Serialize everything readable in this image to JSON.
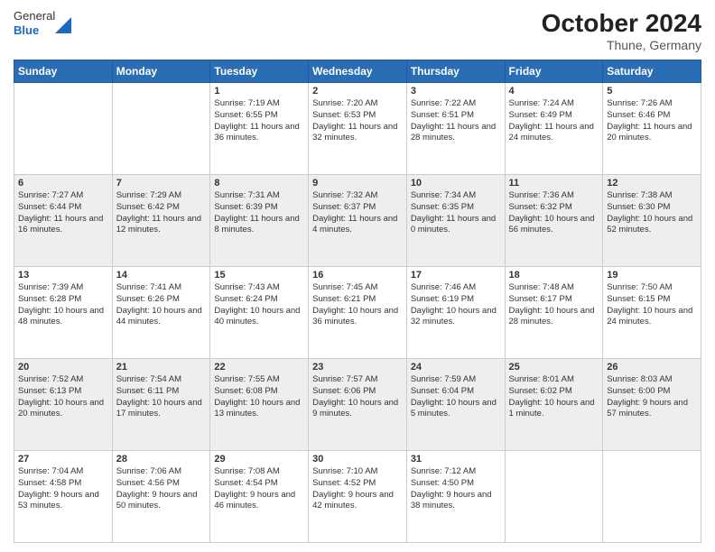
{
  "logo": {
    "line1": "General",
    "line2": "Blue"
  },
  "title": "October 2024",
  "subtitle": "Thune, Germany",
  "days": [
    "Sunday",
    "Monday",
    "Tuesday",
    "Wednesday",
    "Thursday",
    "Friday",
    "Saturday"
  ],
  "weeks": [
    [
      {
        "num": "",
        "content": ""
      },
      {
        "num": "",
        "content": ""
      },
      {
        "num": "1",
        "content": "Sunrise: 7:19 AM\nSunset: 6:55 PM\nDaylight: 11 hours and 36 minutes."
      },
      {
        "num": "2",
        "content": "Sunrise: 7:20 AM\nSunset: 6:53 PM\nDaylight: 11 hours and 32 minutes."
      },
      {
        "num": "3",
        "content": "Sunrise: 7:22 AM\nSunset: 6:51 PM\nDaylight: 11 hours and 28 minutes."
      },
      {
        "num": "4",
        "content": "Sunrise: 7:24 AM\nSunset: 6:49 PM\nDaylight: 11 hours and 24 minutes."
      },
      {
        "num": "5",
        "content": "Sunrise: 7:26 AM\nSunset: 6:46 PM\nDaylight: 11 hours and 20 minutes."
      }
    ],
    [
      {
        "num": "6",
        "content": "Sunrise: 7:27 AM\nSunset: 6:44 PM\nDaylight: 11 hours and 16 minutes."
      },
      {
        "num": "7",
        "content": "Sunrise: 7:29 AM\nSunset: 6:42 PM\nDaylight: 11 hours and 12 minutes."
      },
      {
        "num": "8",
        "content": "Sunrise: 7:31 AM\nSunset: 6:39 PM\nDaylight: 11 hours and 8 minutes."
      },
      {
        "num": "9",
        "content": "Sunrise: 7:32 AM\nSunset: 6:37 PM\nDaylight: 11 hours and 4 minutes."
      },
      {
        "num": "10",
        "content": "Sunrise: 7:34 AM\nSunset: 6:35 PM\nDaylight: 11 hours and 0 minutes."
      },
      {
        "num": "11",
        "content": "Sunrise: 7:36 AM\nSunset: 6:32 PM\nDaylight: 10 hours and 56 minutes."
      },
      {
        "num": "12",
        "content": "Sunrise: 7:38 AM\nSunset: 6:30 PM\nDaylight: 10 hours and 52 minutes."
      }
    ],
    [
      {
        "num": "13",
        "content": "Sunrise: 7:39 AM\nSunset: 6:28 PM\nDaylight: 10 hours and 48 minutes."
      },
      {
        "num": "14",
        "content": "Sunrise: 7:41 AM\nSunset: 6:26 PM\nDaylight: 10 hours and 44 minutes."
      },
      {
        "num": "15",
        "content": "Sunrise: 7:43 AM\nSunset: 6:24 PM\nDaylight: 10 hours and 40 minutes."
      },
      {
        "num": "16",
        "content": "Sunrise: 7:45 AM\nSunset: 6:21 PM\nDaylight: 10 hours and 36 minutes."
      },
      {
        "num": "17",
        "content": "Sunrise: 7:46 AM\nSunset: 6:19 PM\nDaylight: 10 hours and 32 minutes."
      },
      {
        "num": "18",
        "content": "Sunrise: 7:48 AM\nSunset: 6:17 PM\nDaylight: 10 hours and 28 minutes."
      },
      {
        "num": "19",
        "content": "Sunrise: 7:50 AM\nSunset: 6:15 PM\nDaylight: 10 hours and 24 minutes."
      }
    ],
    [
      {
        "num": "20",
        "content": "Sunrise: 7:52 AM\nSunset: 6:13 PM\nDaylight: 10 hours and 20 minutes."
      },
      {
        "num": "21",
        "content": "Sunrise: 7:54 AM\nSunset: 6:11 PM\nDaylight: 10 hours and 17 minutes."
      },
      {
        "num": "22",
        "content": "Sunrise: 7:55 AM\nSunset: 6:08 PM\nDaylight: 10 hours and 13 minutes."
      },
      {
        "num": "23",
        "content": "Sunrise: 7:57 AM\nSunset: 6:06 PM\nDaylight: 10 hours and 9 minutes."
      },
      {
        "num": "24",
        "content": "Sunrise: 7:59 AM\nSunset: 6:04 PM\nDaylight: 10 hours and 5 minutes."
      },
      {
        "num": "25",
        "content": "Sunrise: 8:01 AM\nSunset: 6:02 PM\nDaylight: 10 hours and 1 minute."
      },
      {
        "num": "26",
        "content": "Sunrise: 8:03 AM\nSunset: 6:00 PM\nDaylight: 9 hours and 57 minutes."
      }
    ],
    [
      {
        "num": "27",
        "content": "Sunrise: 7:04 AM\nSunset: 4:58 PM\nDaylight: 9 hours and 53 minutes."
      },
      {
        "num": "28",
        "content": "Sunrise: 7:06 AM\nSunset: 4:56 PM\nDaylight: 9 hours and 50 minutes."
      },
      {
        "num": "29",
        "content": "Sunrise: 7:08 AM\nSunset: 4:54 PM\nDaylight: 9 hours and 46 minutes."
      },
      {
        "num": "30",
        "content": "Sunrise: 7:10 AM\nSunset: 4:52 PM\nDaylight: 9 hours and 42 minutes."
      },
      {
        "num": "31",
        "content": "Sunrise: 7:12 AM\nSunset: 4:50 PM\nDaylight: 9 hours and 38 minutes."
      },
      {
        "num": "",
        "content": ""
      },
      {
        "num": "",
        "content": ""
      }
    ]
  ]
}
